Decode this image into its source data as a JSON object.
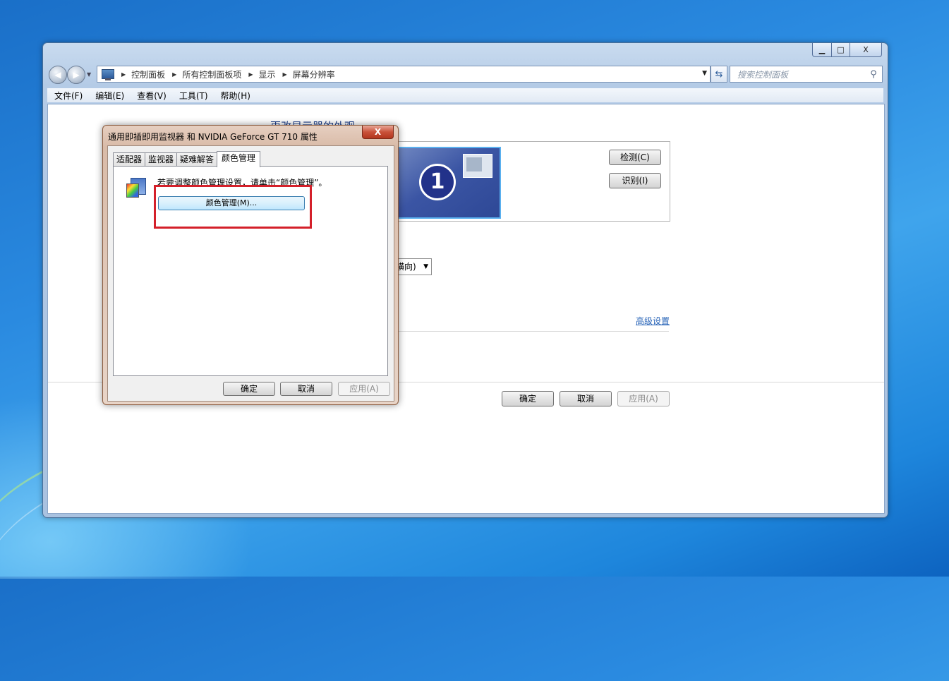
{
  "window": {
    "controls": {
      "minimize": "▁",
      "maximize": "□",
      "close": "X"
    },
    "breadcrumb": [
      "控制面板",
      "所有控制面板项",
      "显示",
      "屏幕分辨率"
    ],
    "search_placeholder": "搜索控制面板",
    "menu": [
      "文件(F)",
      "编辑(E)",
      "查看(V)",
      "工具(T)",
      "帮助(H)"
    ]
  },
  "main": {
    "heading": "更改显示器的外观",
    "monitor_number": "1",
    "detect_button": "检测(C)",
    "identify_button": "识别(I)",
    "orientation_value": "横向)",
    "advanced_link": "高级设置",
    "ok_button": "确定",
    "cancel_button": "取消",
    "apply_button": "应用(A)"
  },
  "dialog": {
    "title": "通用即插即用监视器 和 NVIDIA GeForce GT 710 属性",
    "close": "X",
    "tabs": [
      "适配器",
      "监视器",
      "疑难解答",
      "颜色管理"
    ],
    "active_tab": "颜色管理",
    "instruction": "若要调整颜色管理设置，请单击“颜色管理”。",
    "color_mgmt_button": "颜色管理(M)...",
    "ok_button": "确定",
    "cancel_button": "取消",
    "apply_button": "应用(A)"
  },
  "colors": {
    "highlight": "#d4202a",
    "link": "#2a65b8"
  }
}
